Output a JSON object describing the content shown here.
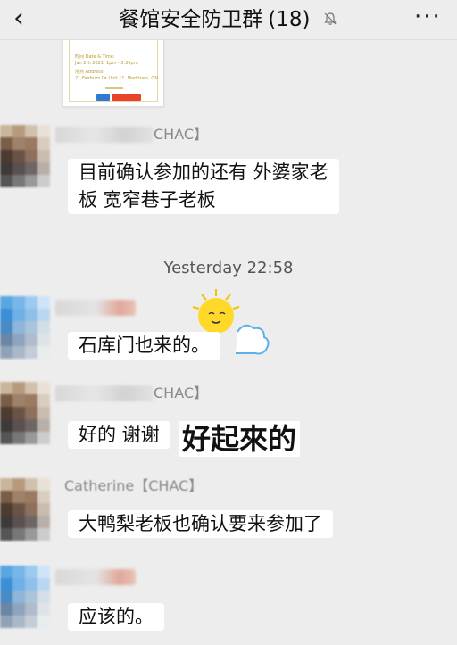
{
  "header": {
    "back_symbol": "‹",
    "title": "餐馆安全防卫群",
    "member_count": "(18)",
    "more_symbol": "···"
  },
  "shared_card": {
    "datetime_label": "时间 Date & Time:",
    "datetime_value": "Jan 2th 2021, 1pm - 3:30pm",
    "address_label": "地点 Address:",
    "address_value": "21 Fairburn Dr Unit 11, Markham, ON"
  },
  "messages": [
    {
      "nick_suffix": "CHAC】",
      "lines": [
        "目前确认参加的还有 外婆家老",
        "板 宽窄巷子老板"
      ]
    },
    {
      "lines": [
        "石库门也来的。"
      ]
    },
    {
      "nick_suffix": "CHAC】",
      "lines": [
        "好的 谢谢"
      ]
    },
    {
      "nick_suffix": "Catherine【CHAC】",
      "lines": [
        "大鸭梨老板也确认要来参加了"
      ]
    },
    {
      "lines": [
        "应该的。"
      ]
    }
  ],
  "timestamp": "Yesterday 22:58",
  "sticker_text": "好起來的",
  "colors": {
    "background": "#ededed",
    "bubble": "#ffffff",
    "card_border": "#e6d9a8"
  }
}
